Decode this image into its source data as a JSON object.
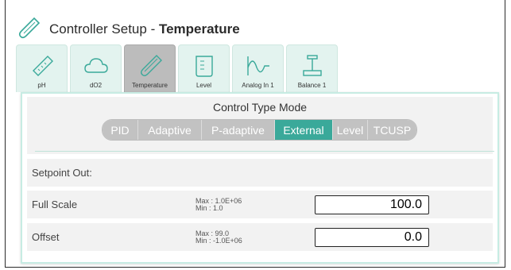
{
  "header": {
    "title_prefix": "Controller Setup - ",
    "title_bold": "Temperature"
  },
  "tabs": [
    {
      "label": "pH"
    },
    {
      "label": "dO2"
    },
    {
      "label": "Temperature"
    },
    {
      "label": "Level"
    },
    {
      "label": "Analog In 1"
    },
    {
      "label": "Balance 1"
    }
  ],
  "control_mode": {
    "title": "Control Type Mode",
    "options": [
      "PID",
      "Adaptive",
      "P-adaptive",
      "External",
      "Level",
      "TCUSP"
    ],
    "selected": "External"
  },
  "setpoint": {
    "label": "Setpoint Out:"
  },
  "full_scale": {
    "label": "Full Scale",
    "max": "Max  : 1.0E+06",
    "min": "Min   : 1.0",
    "value": "100.0"
  },
  "offset": {
    "label": "Offset",
    "max": "Max  : 99.0",
    "min": "Min   : -1.0E+06",
    "value": "0.0"
  },
  "colors": {
    "accent": "#3aa99a",
    "tab_bg": "#e3f3ef",
    "tab_active": "#bcbcbc",
    "panel_border": "#c7ece3"
  }
}
